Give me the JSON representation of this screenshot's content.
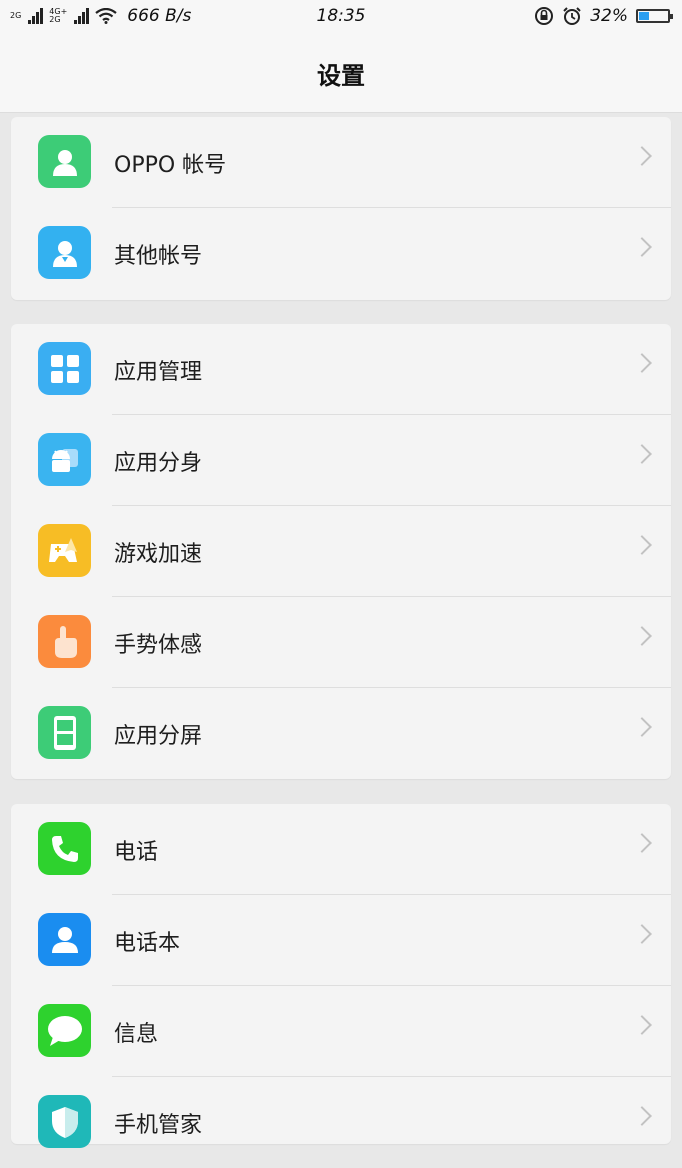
{
  "status_bar": {
    "sim1_label": "2G",
    "sim2_label_top": "4G+",
    "sim2_label_bottom": "2G",
    "net_speed": "666 B/s",
    "time": "18:35",
    "battery_percent": "32%",
    "battery_level": 0.32
  },
  "header": {
    "title": "设置"
  },
  "groups": [
    {
      "items": [
        {
          "label": "OPPO 帐号",
          "icon": "account-icon",
          "color": "#3dcc77"
        },
        {
          "label": "其他帐号",
          "icon": "other-account-icon",
          "color": "#33b1f0"
        }
      ]
    },
    {
      "items": [
        {
          "label": "应用管理",
          "icon": "app-grid-icon",
          "color": "#3aaef2"
        },
        {
          "label": "应用分身",
          "icon": "app-clone-icon",
          "color": "#3ab4f0"
        },
        {
          "label": "游戏加速",
          "icon": "game-rocket-icon",
          "color": "#f7bd25"
        },
        {
          "label": "手势体感",
          "icon": "gesture-hand-icon",
          "color": "#fb8b3d"
        },
        {
          "label": "应用分屏",
          "icon": "split-screen-icon",
          "color": "#3dcc77"
        }
      ]
    },
    {
      "items": [
        {
          "label": "电话",
          "icon": "phone-icon",
          "color": "#2ed22e"
        },
        {
          "label": "电话本",
          "icon": "contacts-icon",
          "color": "#1a8df0"
        },
        {
          "label": "信息",
          "icon": "message-icon",
          "color": "#2ed22e"
        },
        {
          "label": "手机管家",
          "icon": "phone-manager-icon",
          "color": "#1fb8b8"
        }
      ]
    }
  ]
}
